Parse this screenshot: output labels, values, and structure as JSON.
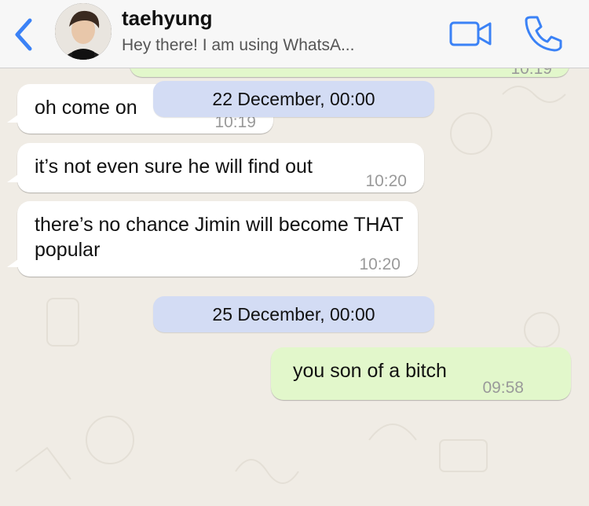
{
  "header": {
    "contact_name": "taehyung",
    "status": "Hey there! I am using WhatsA..."
  },
  "icons": {
    "back": "chevron-left-icon",
    "video": "video-camera-icon",
    "call": "phone-icon"
  },
  "colors": {
    "accent": "#3b82f6",
    "incoming_bubble": "#ffffff",
    "outgoing_bubble": "#e2f7cb",
    "date_pill": "#d3dcf4"
  },
  "messages": [
    {
      "direction": "outgoing",
      "text": "",
      "time": "10:19"
    },
    {
      "direction": "incoming",
      "text": "oh come on",
      "time": "10:19"
    },
    {
      "direction": "incoming",
      "text": "it’s not even sure he will find out",
      "time": "10:20"
    },
    {
      "direction": "incoming",
      "text": "there’s no chance Jimin will become THAT popular",
      "time": "10:20"
    },
    {
      "direction": "outgoing",
      "text": "you son of a bitch",
      "time": "09:58"
    }
  ],
  "date_separators": [
    "22 December, 00:00",
    "25 December, 00:00"
  ]
}
